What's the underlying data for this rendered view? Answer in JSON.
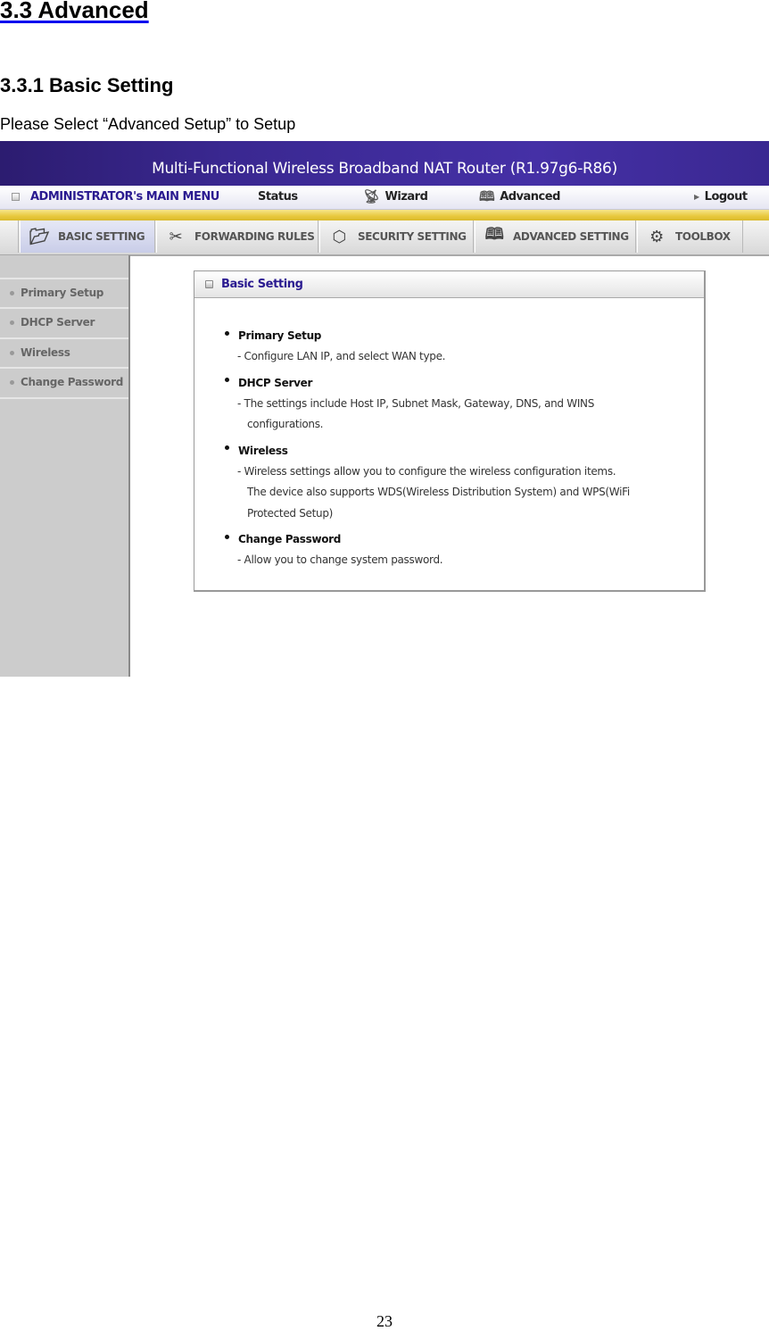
{
  "document": {
    "section_title": "3.3 Advanced",
    "subsection_title": "3.3.1 Basic Setting",
    "intro": "Please Select “Advanced Setup” to Setup",
    "page_number": "23"
  },
  "router_ui": {
    "window_title": "Multi-Functional Wireless Broadband NAT Router (R1.97g6-R86)",
    "main_menu": {
      "admin_label": "ADMINISTRATOR's MAIN MENU",
      "items": [
        {
          "label": "Status",
          "icon": "status-person-icon"
        },
        {
          "label": "Wizard",
          "icon": "wizard-icon"
        },
        {
          "label": "Advanced",
          "icon": "advanced-book-icon"
        },
        {
          "label": "Logout",
          "icon": "triangle-right-icon"
        }
      ]
    },
    "tabs": [
      {
        "label": "BASIC SETTING",
        "icon": "folder-icon",
        "active": true
      },
      {
        "label": "FORWARDING RULES",
        "icon": "forwarding-icon",
        "active": false
      },
      {
        "label": "SECURITY SETTING",
        "icon": "security-nut-icon",
        "active": false
      },
      {
        "label": "ADVANCED SETTING",
        "icon": "advanced-book-icon",
        "active": false
      },
      {
        "label": "TOOLBOX",
        "icon": "toolbox-gear-icon",
        "active": false
      }
    ],
    "sidebar": {
      "items": [
        {
          "label": "Primary Setup"
        },
        {
          "label": "DHCP Server"
        },
        {
          "label": "Wireless"
        },
        {
          "label": "Change Password"
        }
      ]
    },
    "panel": {
      "title": "Basic Setting",
      "entries": [
        {
          "name": "Primary Setup",
          "lines": [
            "- Configure LAN IP, and select WAN type."
          ]
        },
        {
          "name": "DHCP Server",
          "lines": [
            "- The settings include Host IP, Subnet Mask, Gateway, DNS, and WINS",
            "configurations."
          ]
        },
        {
          "name": "Wireless",
          "lines": [
            "- Wireless settings allow you to configure the wireless configuration items.",
            "The device also supports WDS(Wireless Distribution System) and WPS(WiFi",
            "Protected Setup)"
          ]
        },
        {
          "name": "Change Password",
          "lines": [
            "- Allow you to change system password."
          ]
        }
      ]
    }
  }
}
